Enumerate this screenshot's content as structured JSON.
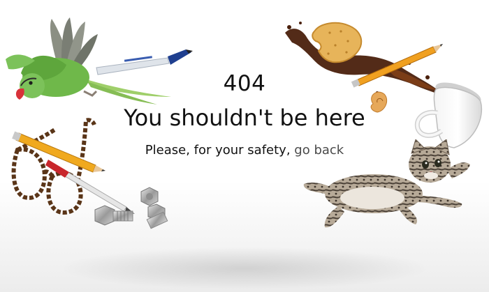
{
  "error": {
    "code": "404",
    "title": "You shouldn't be here",
    "message_prefix": "Please, for your safety, ",
    "back_link": "go back"
  },
  "illustrations": [
    "parrot-with-pen",
    "eyeglasses-pencil-pen",
    "bolts-and-nuts",
    "cookie-coffee-splash-pencil",
    "coffee-cup",
    "flying-kitten"
  ],
  "colors": {
    "text": "#111111",
    "link": "#4a4a4a",
    "background": "#ffffff"
  }
}
